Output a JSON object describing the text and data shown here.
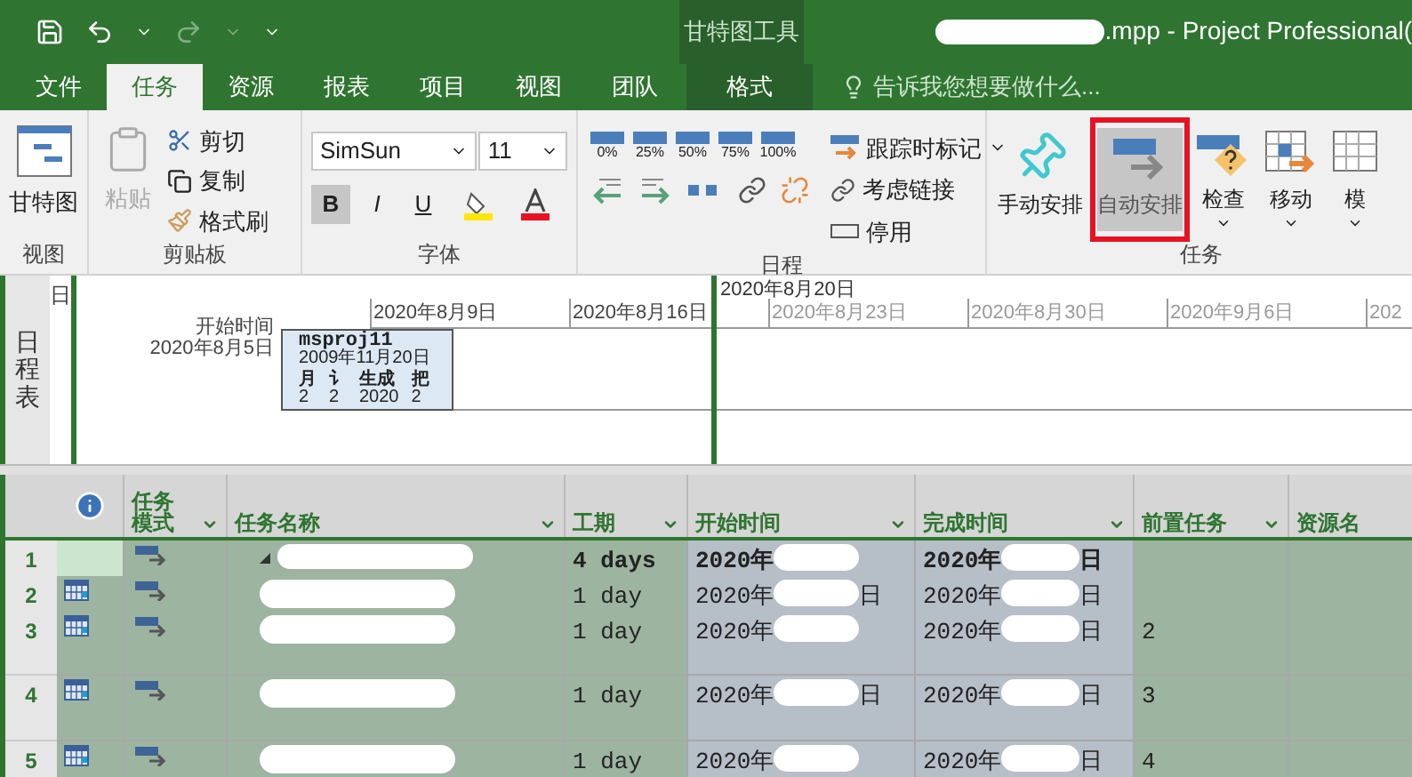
{
  "window": {
    "context_group": "甘特图工具",
    "title": ".mpp - Project Professional("
  },
  "tabs": [
    {
      "label": "文件",
      "kind": "file",
      "selected": false
    },
    {
      "label": "任务",
      "kind": "normal",
      "selected": true
    },
    {
      "label": "资源",
      "kind": "normal",
      "selected": false
    },
    {
      "label": "报表",
      "kind": "normal",
      "selected": false
    },
    {
      "label": "项目",
      "kind": "normal",
      "selected": false
    },
    {
      "label": "视图",
      "kind": "normal",
      "selected": false
    },
    {
      "label": "团队",
      "kind": "normal",
      "selected": false
    },
    {
      "label": "格式",
      "kind": "context",
      "selected": false
    }
  ],
  "tell_me": {
    "placeholder": "告诉我您想要做什么..."
  },
  "ribbon": {
    "view": {
      "label": "视图",
      "gantt": "甘特图"
    },
    "clipboard": {
      "label": "剪贴板",
      "paste": {
        "label": "粘贴",
        "disabled": true
      },
      "cut": "剪切",
      "copy": "复制",
      "painter": "格式刷"
    },
    "font": {
      "label": "字体",
      "name": "SimSun",
      "size": "11",
      "bold": {
        "label": "B",
        "selected": true
      },
      "italic": "I",
      "underline": "U"
    },
    "schedule": {
      "label": "日程",
      "percents": [
        "0%",
        "25%",
        "50%",
        "75%",
        "100%"
      ],
      "track": "跟踪时标记",
      "links": "考虑链接",
      "inactivate": "停用"
    },
    "tasks": {
      "label": "任务",
      "buttons": [
        {
          "label": "手动安排",
          "kind": "pin",
          "selected": false,
          "highlighted": false
        },
        {
          "label": "自动安排",
          "kind": "auto",
          "selected": true,
          "highlighted": true
        },
        {
          "label": "检查",
          "kind": "inspect",
          "selected": false,
          "highlighted": false
        },
        {
          "label": "移动",
          "kind": "move",
          "selected": false,
          "highlighted": false
        },
        {
          "label": "模",
          "kind": "mode",
          "selected": false,
          "highlighted": false
        }
      ]
    }
  },
  "timeline": {
    "side_label": "日程表",
    "left_fragment": "日",
    "current_date": "2020年8月20日",
    "start_label": "开始时间",
    "start_date": "2020年8月5日",
    "ticks": [
      "2020年8月9日",
      "2020年8月16日",
      "2020年8月23日",
      "2020年8月30日",
      "2020年9月6日",
      "202"
    ],
    "bar": {
      "title": "msproj11",
      "date": "2009年11月20日",
      "fields": [
        {
          "label": "月",
          "value": "2"
        },
        {
          "label": "讠",
          "value": "2"
        },
        {
          "label": "生成",
          "value": "2020"
        },
        {
          "label": "把",
          "value": "2"
        }
      ]
    }
  },
  "table": {
    "columns": [
      {
        "kind": "info"
      },
      {
        "kind": "text",
        "label": "任务",
        "label2": "模式"
      },
      {
        "kind": "text",
        "label": "任务名称"
      },
      {
        "kind": "text",
        "label": "工期"
      },
      {
        "kind": "text",
        "label": "开始时间"
      },
      {
        "kind": "text",
        "label": "完成时间"
      },
      {
        "kind": "text",
        "label": "前置任务"
      },
      {
        "kind": "text",
        "label": "资源名"
      }
    ],
    "rows": [
      {
        "id": "1",
        "kind": "summary",
        "duration": "4 days",
        "start": "2020年",
        "start_end": "",
        "finish": "2020年",
        "finish_end": "日",
        "predecessors": ""
      },
      {
        "id": "2",
        "kind": "task",
        "duration": "1 day",
        "start": "2020年",
        "start_end": "日",
        "finish": "2020年",
        "finish_end": "日",
        "predecessors": ""
      },
      {
        "id": "3",
        "kind": "task",
        "duration": "1 day",
        "start": "2020年",
        "start_end": "",
        "finish": "2020年",
        "finish_end": "日",
        "predecessors": "2"
      },
      {
        "id": "4",
        "kind": "task",
        "duration": "1 day",
        "start": "2020年",
        "start_end": "日",
        "finish": "2020年",
        "finish_end": "日",
        "predecessors": "3"
      },
      {
        "id": "5",
        "kind": "task",
        "duration": "1 day",
        "start": "2020年",
        "start_end": "",
        "finish": "2020年",
        "finish_end": "日",
        "predecessors": "4"
      }
    ]
  }
}
